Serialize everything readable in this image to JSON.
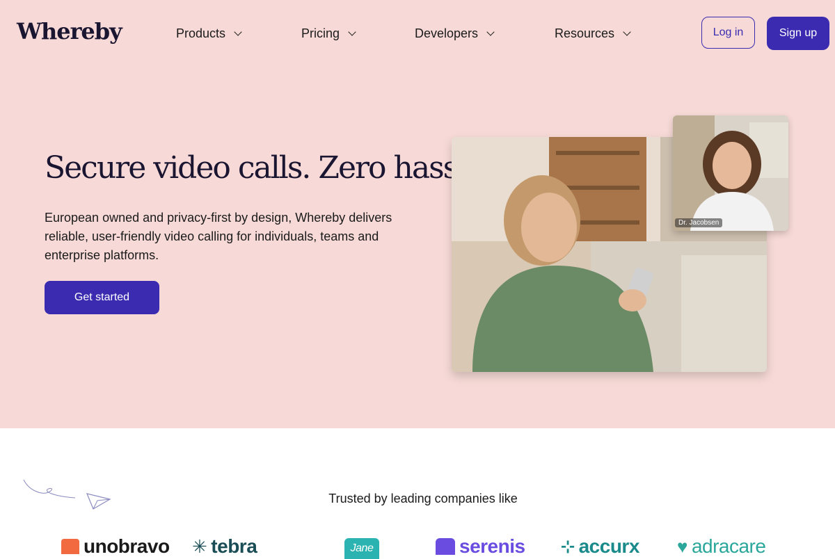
{
  "header": {
    "logo": "Whereby",
    "nav": [
      "Products",
      "Pricing",
      "Developers",
      "Resources"
    ],
    "login_label": "Log in",
    "signup_label": "Sign up"
  },
  "hero": {
    "title": "Secure video calls. Zero hassle",
    "description": "European owned and privacy-first by design, Whereby delivers reliable, user-friendly video calling for individuals, teams and enterprise platforms.",
    "cta_label": "Get started",
    "pip_name": "Dr. Jacobsen"
  },
  "trusted": {
    "heading": "Trusted by leading companies like",
    "companies": [
      "unobravo",
      "tebra",
      "Jane",
      "serenis",
      "accurx",
      "adracare"
    ]
  },
  "colors": {
    "hero_bg": "#f7dad7",
    "brand": "#3a2bb0"
  }
}
